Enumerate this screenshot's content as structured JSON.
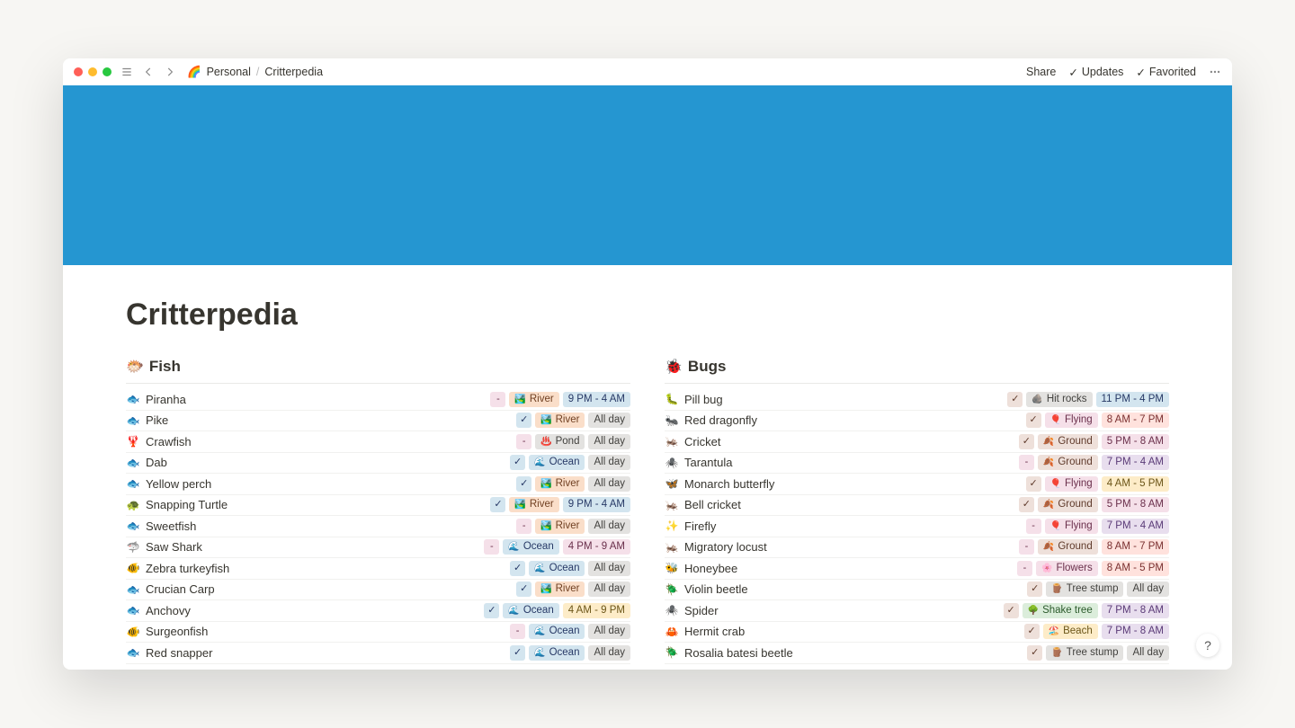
{
  "topbar": {
    "share": "Share",
    "updates": "Updates",
    "favorited": "Favorited"
  },
  "breadcrumb": {
    "icon": "🌈",
    "parent": "Personal",
    "current": "Critterpedia"
  },
  "page": {
    "title": "Critterpedia"
  },
  "fish": {
    "header_emoji": "🐡",
    "header": "Fish",
    "rows": [
      {
        "icon": "🐟",
        "name": "Piranha",
        "check": "-",
        "check_c": "pink",
        "loc_e": "🏞️",
        "loc": "River",
        "loc_c": "orange",
        "time": "9 PM - 4 AM",
        "time_c": "blue"
      },
      {
        "icon": "🐟",
        "name": "Pike",
        "check": "✓",
        "check_c": "blue",
        "loc_e": "🏞️",
        "loc": "River",
        "loc_c": "orange",
        "time": "All day",
        "time_c": "gray"
      },
      {
        "icon": "🦞",
        "name": "Crawfish",
        "check": "-",
        "check_c": "pink",
        "loc_e": "♨️",
        "loc": "Pond",
        "loc_c": "gray",
        "time": "All day",
        "time_c": "gray"
      },
      {
        "icon": "🐟",
        "name": "Dab",
        "check": "✓",
        "check_c": "blue",
        "loc_e": "🌊",
        "loc": "Ocean",
        "loc_c": "blue",
        "time": "All day",
        "time_c": "gray"
      },
      {
        "icon": "🐟",
        "name": "Yellow perch",
        "check": "✓",
        "check_c": "blue",
        "loc_e": "🏞️",
        "loc": "River",
        "loc_c": "orange",
        "time": "All day",
        "time_c": "gray"
      },
      {
        "icon": "🐢",
        "name": "Snapping Turtle",
        "check": "✓",
        "check_c": "blue",
        "loc_e": "🏞️",
        "loc": "River",
        "loc_c": "orange",
        "time": "9 PM - 4 AM",
        "time_c": "blue"
      },
      {
        "icon": "🐟",
        "name": "Sweetfish",
        "check": "-",
        "check_c": "pink",
        "loc_e": "🏞️",
        "loc": "River",
        "loc_c": "orange",
        "time": "All day",
        "time_c": "gray"
      },
      {
        "icon": "🦈",
        "name": "Saw Shark",
        "check": "-",
        "check_c": "pink",
        "loc_e": "🌊",
        "loc": "Ocean",
        "loc_c": "blue",
        "time": "4 PM - 9 AM",
        "time_c": "pink"
      },
      {
        "icon": "🐠",
        "name": "Zebra turkeyfish",
        "check": "✓",
        "check_c": "blue",
        "loc_e": "🌊",
        "loc": "Ocean",
        "loc_c": "blue",
        "time": "All day",
        "time_c": "gray"
      },
      {
        "icon": "🐟",
        "name": "Crucian Carp",
        "check": "✓",
        "check_c": "blue",
        "loc_e": "🏞️",
        "loc": "River",
        "loc_c": "orange",
        "time": "All day",
        "time_c": "gray"
      },
      {
        "icon": "🐟",
        "name": "Anchovy",
        "check": "✓",
        "check_c": "blue",
        "loc_e": "🌊",
        "loc": "Ocean",
        "loc_c": "blue",
        "time": "4 AM - 9 PM",
        "time_c": "yellow"
      },
      {
        "icon": "🐠",
        "name": "Surgeonfish",
        "check": "-",
        "check_c": "pink",
        "loc_e": "🌊",
        "loc": "Ocean",
        "loc_c": "blue",
        "time": "All day",
        "time_c": "gray"
      },
      {
        "icon": "🐟",
        "name": "Red snapper",
        "check": "✓",
        "check_c": "blue",
        "loc_e": "🌊",
        "loc": "Ocean",
        "loc_c": "blue",
        "time": "All day",
        "time_c": "gray"
      }
    ]
  },
  "bugs": {
    "header_emoji": "🐞",
    "header": "Bugs",
    "rows": [
      {
        "icon": "🐛",
        "name": "Pill bug",
        "check": "✓",
        "check_c": "brown",
        "loc_e": "🪨",
        "loc": "Hit rocks",
        "loc_c": "gray",
        "time": "11 PM - 4 PM",
        "time_c": "blue"
      },
      {
        "icon": "🐜",
        "name": "Red dragonfly",
        "check": "✓",
        "check_c": "brown",
        "loc_e": "🎈",
        "loc": "Flying",
        "loc_c": "pink",
        "time": "8 AM - 7 PM",
        "time_c": "red"
      },
      {
        "icon": "🦗",
        "name": "Cricket",
        "check": "✓",
        "check_c": "brown",
        "loc_e": "🍂",
        "loc": "Ground",
        "loc_c": "brown",
        "time": "5 PM - 8 AM",
        "time_c": "pink"
      },
      {
        "icon": "🕷️",
        "name": "Tarantula",
        "check": "-",
        "check_c": "pink",
        "loc_e": "🍂",
        "loc": "Ground",
        "loc_c": "brown",
        "time": "7 PM - 4 AM",
        "time_c": "purple"
      },
      {
        "icon": "🦋",
        "name": "Monarch butterfly",
        "check": "✓",
        "check_c": "brown",
        "loc_e": "🎈",
        "loc": "Flying",
        "loc_c": "pink",
        "time": "4 AM - 5 PM",
        "time_c": "yellow"
      },
      {
        "icon": "🦗",
        "name": "Bell cricket",
        "check": "✓",
        "check_c": "brown",
        "loc_e": "🍂",
        "loc": "Ground",
        "loc_c": "brown",
        "time": "5 PM - 8 AM",
        "time_c": "pink"
      },
      {
        "icon": "✨",
        "name": "Firefly",
        "check": "-",
        "check_c": "pink",
        "loc_e": "🎈",
        "loc": "Flying",
        "loc_c": "pink",
        "time": "7 PM - 4 AM",
        "time_c": "purple"
      },
      {
        "icon": "🦗",
        "name": "Migratory locust",
        "check": "-",
        "check_c": "pink",
        "loc_e": "🍂",
        "loc": "Ground",
        "loc_c": "brown",
        "time": "8 AM - 7 PM",
        "time_c": "red"
      },
      {
        "icon": "🐝",
        "name": "Honeybee",
        "check": "-",
        "check_c": "pink",
        "loc_e": "🌸",
        "loc": "Flowers",
        "loc_c": "pink",
        "time": "8 AM - 5 PM",
        "time_c": "red"
      },
      {
        "icon": "🪲",
        "name": "Violin beetle",
        "check": "✓",
        "check_c": "brown",
        "loc_e": "🪵",
        "loc": "Tree stump",
        "loc_c": "gray",
        "time": "All day",
        "time_c": "gray"
      },
      {
        "icon": "🕷️",
        "name": "Spider",
        "check": "✓",
        "check_c": "brown",
        "loc_e": "🌳",
        "loc": "Shake tree",
        "loc_c": "green",
        "time": "7 PM - 8 AM",
        "time_c": "purple"
      },
      {
        "icon": "🦀",
        "name": "Hermit crab",
        "check": "✓",
        "check_c": "brown",
        "loc_e": "🏖️",
        "loc": "Beach",
        "loc_c": "yellow",
        "time": "7 PM - 8 AM",
        "time_c": "purple"
      },
      {
        "icon": "🪲",
        "name": "Rosalia batesi beetle",
        "check": "✓",
        "check_c": "brown",
        "loc_e": "🪵",
        "loc": "Tree stump",
        "loc_c": "gray",
        "time": "All day",
        "time_c": "gray"
      }
    ]
  }
}
